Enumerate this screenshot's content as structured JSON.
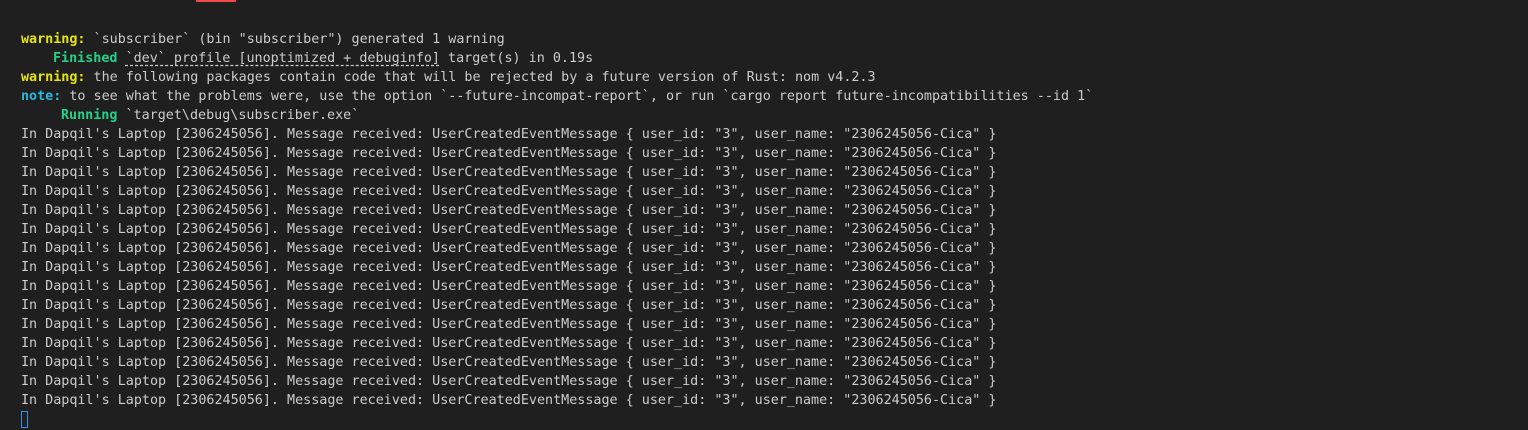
{
  "colors": {
    "background": "#1f1f1f",
    "text": "#cccccc",
    "warning": "#e5e510",
    "note": "#29b8db",
    "success": "#23d18b",
    "cursor": "#3b8eea",
    "tab_indicator": "#f14c4c"
  },
  "header_lines": {
    "warning1_label": "warning:",
    "warning1_text": " `subscriber` (bin \"subscriber\") generated 1 warning",
    "finished_label": "Finished",
    "finished_pre": " ",
    "finished_profile": "`dev` profile [unoptimized + debuginfo]",
    "finished_post": " target(s) in 0.19s",
    "warning2_label": "warning:",
    "warning2_text": " the following packages contain code that will be rejected by a future version of Rust: nom v4.2.3",
    "note_label": "note:",
    "note_text": " to see what the problems were, use the option `--future-incompat-report`, or run `cargo report future-incompatibilities --id 1`",
    "running_label": "Running",
    "running_text": " `target\\debug\\subscriber.exe`"
  },
  "messages": [
    "In Dapqil's Laptop [2306245056]. Message received: UserCreatedEventMessage { user_id: \"3\", user_name: \"2306245056-Cica\" }",
    "In Dapqil's Laptop [2306245056]. Message received: UserCreatedEventMessage { user_id: \"3\", user_name: \"2306245056-Cica\" }",
    "In Dapqil's Laptop [2306245056]. Message received: UserCreatedEventMessage { user_id: \"3\", user_name: \"2306245056-Cica\" }",
    "In Dapqil's Laptop [2306245056]. Message received: UserCreatedEventMessage { user_id: \"3\", user_name: \"2306245056-Cica\" }",
    "In Dapqil's Laptop [2306245056]. Message received: UserCreatedEventMessage { user_id: \"3\", user_name: \"2306245056-Cica\" }",
    "In Dapqil's Laptop [2306245056]. Message received: UserCreatedEventMessage { user_id: \"3\", user_name: \"2306245056-Cica\" }",
    "In Dapqil's Laptop [2306245056]. Message received: UserCreatedEventMessage { user_id: \"3\", user_name: \"2306245056-Cica\" }",
    "In Dapqil's Laptop [2306245056]. Message received: UserCreatedEventMessage { user_id: \"3\", user_name: \"2306245056-Cica\" }",
    "In Dapqil's Laptop [2306245056]. Message received: UserCreatedEventMessage { user_id: \"3\", user_name: \"2306245056-Cica\" }",
    "In Dapqil's Laptop [2306245056]. Message received: UserCreatedEventMessage { user_id: \"3\", user_name: \"2306245056-Cica\" }",
    "In Dapqil's Laptop [2306245056]. Message received: UserCreatedEventMessage { user_id: \"3\", user_name: \"2306245056-Cica\" }",
    "In Dapqil's Laptop [2306245056]. Message received: UserCreatedEventMessage { user_id: \"3\", user_name: \"2306245056-Cica\" }",
    "In Dapqil's Laptop [2306245056]. Message received: UserCreatedEventMessage { user_id: \"3\", user_name: \"2306245056-Cica\" }",
    "In Dapqil's Laptop [2306245056]. Message received: UserCreatedEventMessage { user_id: \"3\", user_name: \"2306245056-Cica\" }",
    "In Dapqil's Laptop [2306245056]. Message received: UserCreatedEventMessage { user_id: \"3\", user_name: \"2306245056-Cica\" }"
  ]
}
